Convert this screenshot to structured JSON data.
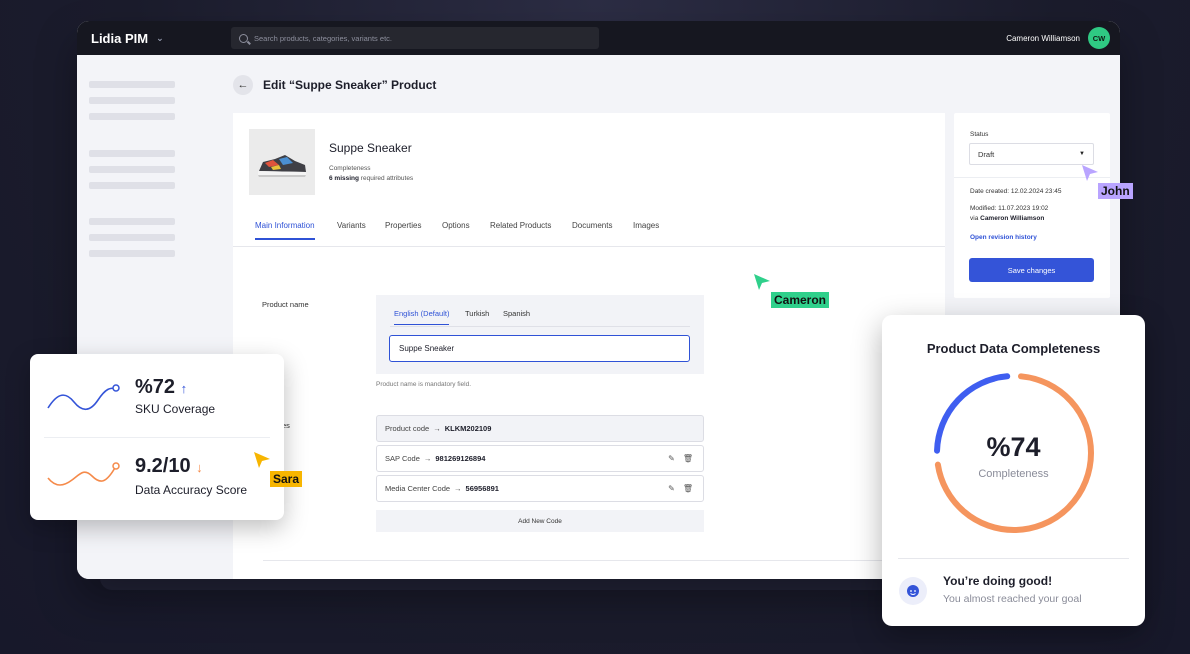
{
  "topbar": {
    "brand": "Lidia PIM",
    "search_placeholder": "Search products, categories, variants etc.",
    "user_name": "Cameron Williamson",
    "user_initials": "CW"
  },
  "page": {
    "title": "Edit “Suppe Sneaker” Product"
  },
  "product": {
    "name": "Suppe Sneaker",
    "completeness_label": "Completeness",
    "missing_count": "6 missing",
    "missing_suffix": "required attributes"
  },
  "tabs": [
    "Main Information",
    "Variants",
    "Properties",
    "Options",
    "Related Products",
    "Documents",
    "Images"
  ],
  "product_name_section": {
    "label": "Product name",
    "languages": [
      "English (Default)",
      "Turkish",
      "Spanish"
    ],
    "value": "Suppe Sneaker",
    "hint": "Product name is mandatory field."
  },
  "codes_section": {
    "label": "ct codes",
    "codes": [
      {
        "name": "Product code",
        "arrow": "→",
        "value": "KLKM202109"
      },
      {
        "name": "SAP Code",
        "arrow": "→",
        "value": "981269126894"
      },
      {
        "name": "Media Center Code",
        "arrow": "→",
        "value": "56956891"
      }
    ],
    "add_label": "Add New Code"
  },
  "status_panel": {
    "label": "Status",
    "value": "Draft",
    "date_created": "Date created: 12.02.2024 23:45",
    "modified": "Modified: 11.07.2023 19:02",
    "via_prefix": "via",
    "via_user": "Cameron Williamson",
    "revision_link": "Open revision history",
    "save_label": "Save changes"
  },
  "cursors": [
    {
      "name": "John",
      "color": "#b9a4ff"
    },
    {
      "name": "Cameron",
      "color": "#2fd08b"
    },
    {
      "name": "Sara",
      "color": "#f7b500"
    }
  ],
  "stats": [
    {
      "value": "%72",
      "trend": "up",
      "trend_glyph": "↑",
      "label": "SKU Coverage",
      "color": "#3454d8"
    },
    {
      "value": "9.2/10",
      "trend": "down",
      "trend_glyph": "↓",
      "label": "Data Accuracy Score",
      "color": "#f58a4a"
    }
  ],
  "completeness_card": {
    "title": "Product Data Completeness",
    "percent_text": "%74",
    "percent_value": 74,
    "sub": "Completeness",
    "message_title": "You’re doing good!",
    "message_sub": "You almost reached your goal",
    "colors": {
      "done": "#f5955e",
      "remaining": "#3f5ef0"
    }
  }
}
